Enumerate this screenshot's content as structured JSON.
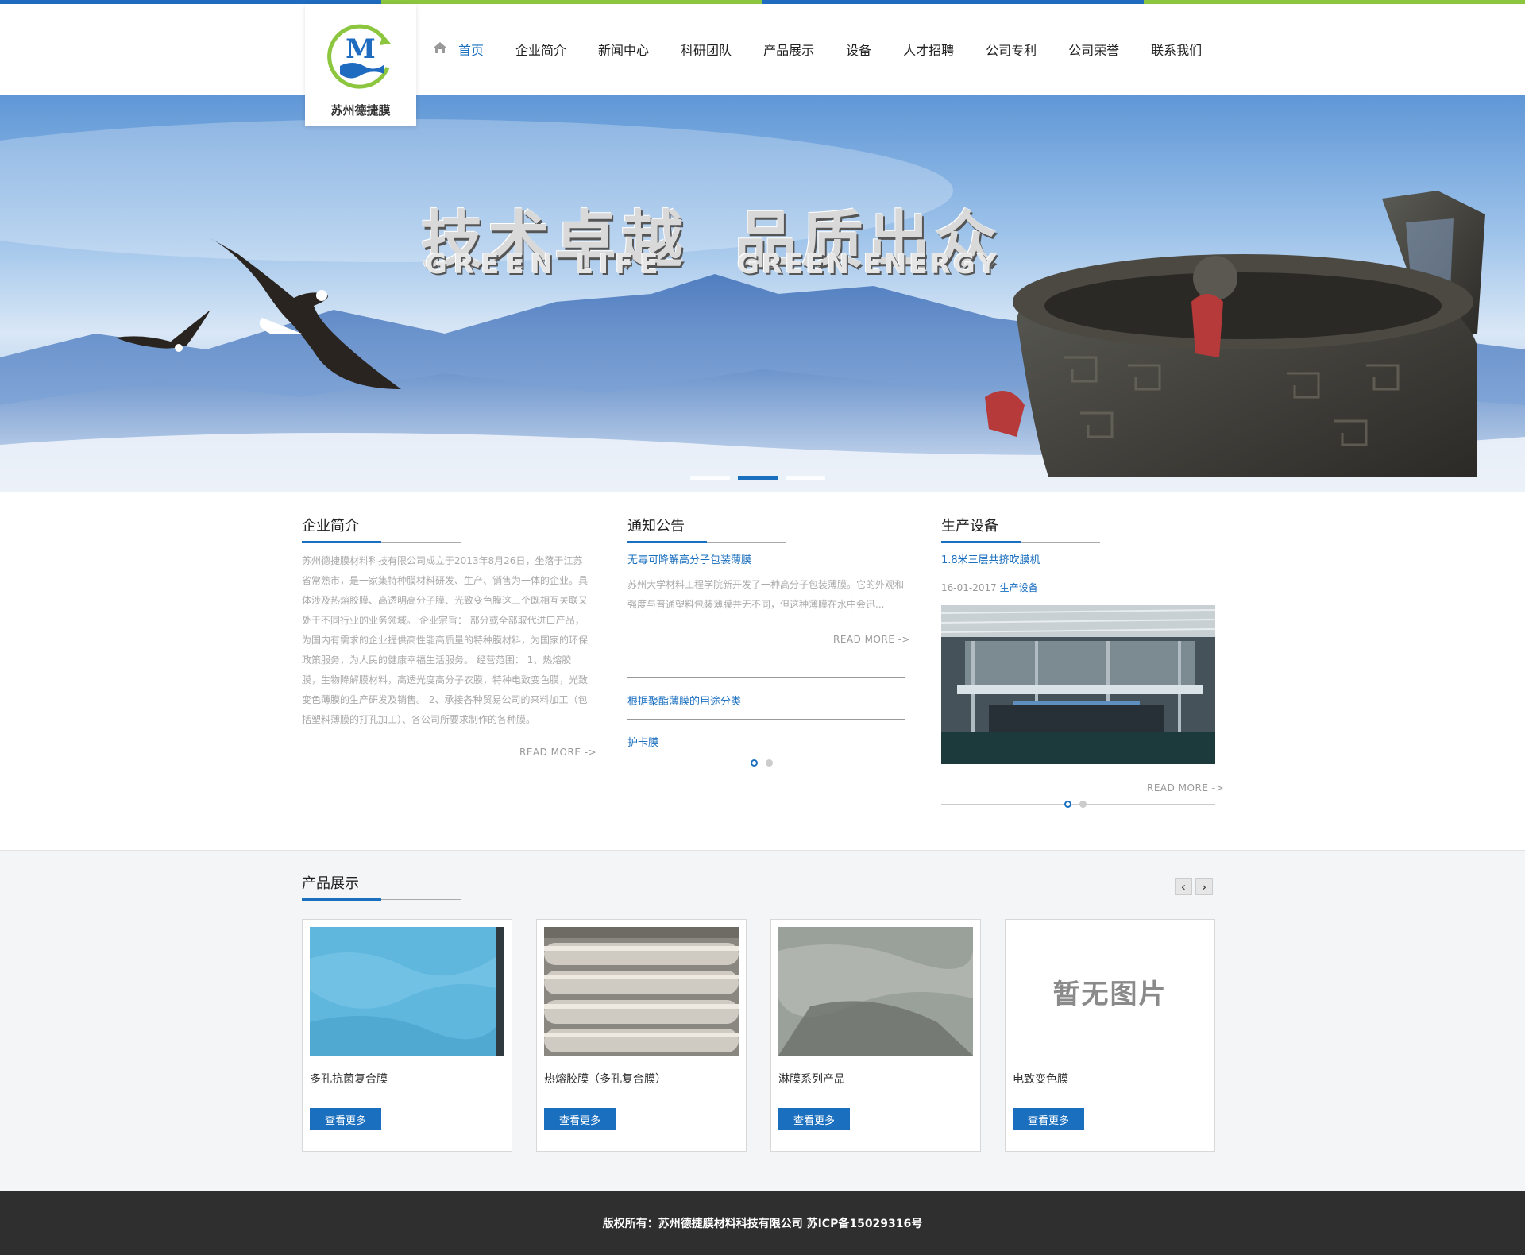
{
  "colors": {
    "accent": "#1a6fbf",
    "topbar_blue": "#1f6bbf",
    "topbar_green": "#8cc63f",
    "footer_bg": "#2f2f2f"
  },
  "logo": {
    "text": "苏州德捷膜",
    "icon": "company-logo"
  },
  "nav": {
    "items": [
      {
        "label": "首页",
        "icon": "home-icon"
      },
      {
        "label": "企业简介"
      },
      {
        "label": "新闻中心"
      },
      {
        "label": "科研团队"
      },
      {
        "label": "产品展示"
      },
      {
        "label": "设备"
      },
      {
        "label": "人才招聘"
      },
      {
        "label": "公司专利"
      },
      {
        "label": "公司荣誉"
      },
      {
        "label": "联系我们"
      }
    ]
  },
  "banner": {
    "title_left": "技术卓越",
    "title_right": "品质出众",
    "sub_left": "GREEN LIFE",
    "sub_right": "GREEN ENERGY",
    "slides": 3,
    "active_slide": 2
  },
  "about": {
    "title": "企业简介",
    "body": "苏州德捷膜材料科技有限公司成立于2013年8月26日，坐落于江苏省常熟市，是一家集特种膜材料研发、生产、销售为一体的企业。具体涉及热熔胶膜、高透明高分子膜、光致变色膜这三个既相互关联又处于不同行业的业务领域。 企业宗旨： 部分或全部取代进口产品，为国内有需求的企业提供高性能高质量的特种膜材料，为国家的环保政策服务，为人民的健康幸福生活服务。 经营范围： 1、热熔胶膜，生物降解膜材料，高透光度高分子农膜，特种电致变色膜，光致变色薄膜的生产研发及销售。 2、承接各种贸易公司的来料加工（包括塑料薄膜的打孔加工）、各公司所要求制作的各种膜。",
    "readmore": "READ MORE ->"
  },
  "notice": {
    "title": "通知公告",
    "items": [
      {
        "title": "无毒可降解高分子包装薄膜",
        "summary": "苏州大学材料工程学院新开发了一种高分子包装薄膜。它的外观和强度与普通塑料包装薄膜并无不同，但这种薄膜在水中会迅..."
      },
      {
        "title": "根据聚酯薄膜的用途分类"
      },
      {
        "title": "护卡膜"
      }
    ],
    "readmore": "READ MORE ->"
  },
  "equipment": {
    "title": "生产设备",
    "item_title": "1.8米三层共挤吹膜机",
    "date": "16-01-2017",
    "category": "生产设备",
    "readmore": "READ MORE ->"
  },
  "products": {
    "title": "产品展示",
    "prev": "‹",
    "next": "›",
    "items": [
      {
        "name": "多孔抗菌复合膜",
        "button": "查看更多"
      },
      {
        "name": "热熔胶膜（多孔复合膜）",
        "button": "查看更多"
      },
      {
        "name": "淋膜系列产品",
        "button": "查看更多"
      },
      {
        "name": "电致变色膜",
        "button": "查看更多",
        "placeholder": "暂无图片"
      }
    ]
  },
  "footer": {
    "text": "版权所有：苏州德捷膜材料科技有限公司 苏ICP备15029316号"
  }
}
